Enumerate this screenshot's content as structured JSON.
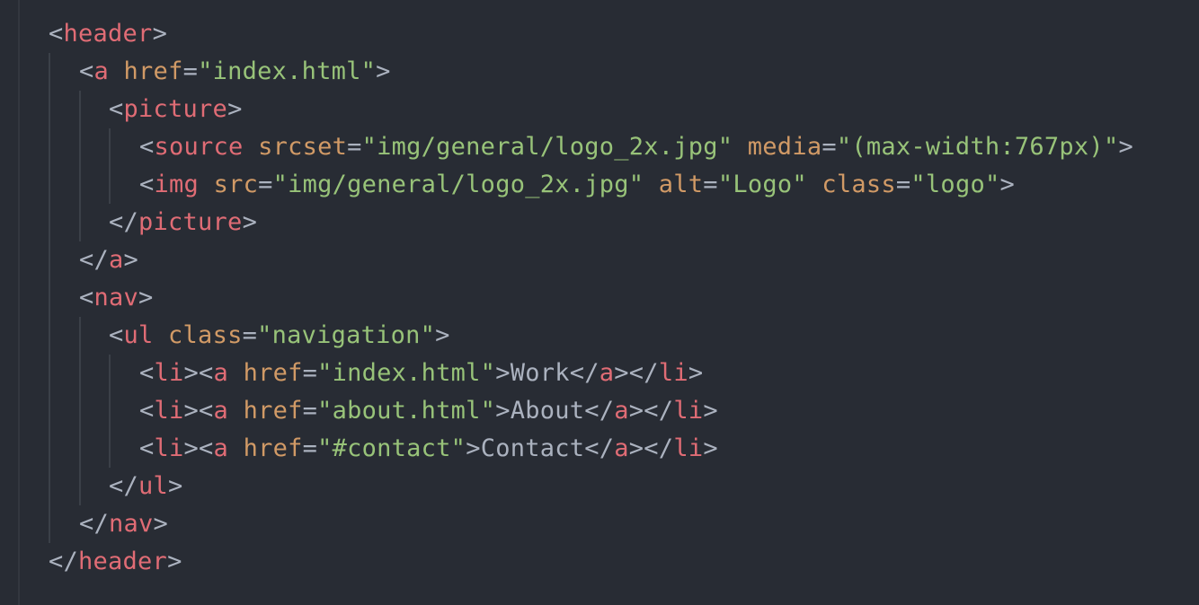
{
  "editor": {
    "colors": {
      "background": "#282c34",
      "punctuation": "#abb2bf",
      "tag": "#e06c75",
      "attribute": "#d19a66",
      "string": "#98c379",
      "text": "#abb2bf"
    },
    "lines": [
      {
        "indent": 0,
        "tokens": [
          {
            "k": "p",
            "v": "<"
          },
          {
            "k": "t",
            "v": "header"
          },
          {
            "k": "p",
            "v": ">"
          }
        ]
      },
      {
        "indent": 1,
        "tokens": [
          {
            "k": "p",
            "v": "<"
          },
          {
            "k": "t",
            "v": "a"
          },
          {
            "k": "p",
            "v": " "
          },
          {
            "k": "a",
            "v": "href"
          },
          {
            "k": "p",
            "v": "="
          },
          {
            "k": "s",
            "v": "\"index.html\""
          },
          {
            "k": "p",
            "v": ">"
          }
        ]
      },
      {
        "indent": 2,
        "tokens": [
          {
            "k": "p",
            "v": "<"
          },
          {
            "k": "t",
            "v": "picture"
          },
          {
            "k": "p",
            "v": ">"
          }
        ]
      },
      {
        "indent": 3,
        "tokens": [
          {
            "k": "p",
            "v": "<"
          },
          {
            "k": "t",
            "v": "source"
          },
          {
            "k": "p",
            "v": " "
          },
          {
            "k": "a",
            "v": "srcset"
          },
          {
            "k": "p",
            "v": "="
          },
          {
            "k": "s",
            "v": "\"img/general/logo_2x.jpg\""
          },
          {
            "k": "p",
            "v": " "
          },
          {
            "k": "a",
            "v": "media"
          },
          {
            "k": "p",
            "v": "="
          },
          {
            "k": "s",
            "v": "\"(max-width:767px)\""
          },
          {
            "k": "p",
            "v": ">"
          }
        ]
      },
      {
        "indent": 3,
        "tokens": [
          {
            "k": "p",
            "v": "<"
          },
          {
            "k": "t",
            "v": "img"
          },
          {
            "k": "p",
            "v": " "
          },
          {
            "k": "a",
            "v": "src"
          },
          {
            "k": "p",
            "v": "="
          },
          {
            "k": "s",
            "v": "\"img/general/logo_2x.jpg\""
          },
          {
            "k": "p",
            "v": " "
          },
          {
            "k": "a",
            "v": "alt"
          },
          {
            "k": "p",
            "v": "="
          },
          {
            "k": "s",
            "v": "\"Logo\""
          },
          {
            "k": "p",
            "v": " "
          },
          {
            "k": "a",
            "v": "class"
          },
          {
            "k": "p",
            "v": "="
          },
          {
            "k": "s",
            "v": "\"logo\""
          },
          {
            "k": "p",
            "v": ">"
          }
        ]
      },
      {
        "indent": 2,
        "tokens": [
          {
            "k": "p",
            "v": "</"
          },
          {
            "k": "t",
            "v": "picture"
          },
          {
            "k": "p",
            "v": ">"
          }
        ]
      },
      {
        "indent": 1,
        "tokens": [
          {
            "k": "p",
            "v": "</"
          },
          {
            "k": "t",
            "v": "a"
          },
          {
            "k": "p",
            "v": ">"
          }
        ]
      },
      {
        "indent": 1,
        "tokens": [
          {
            "k": "p",
            "v": "<"
          },
          {
            "k": "t",
            "v": "nav"
          },
          {
            "k": "p",
            "v": ">"
          }
        ]
      },
      {
        "indent": 2,
        "tokens": [
          {
            "k": "p",
            "v": "<"
          },
          {
            "k": "t",
            "v": "ul"
          },
          {
            "k": "p",
            "v": " "
          },
          {
            "k": "a",
            "v": "class"
          },
          {
            "k": "p",
            "v": "="
          },
          {
            "k": "s",
            "v": "\"navigation\""
          },
          {
            "k": "p",
            "v": ">"
          }
        ]
      },
      {
        "indent": 3,
        "tokens": [
          {
            "k": "p",
            "v": "<"
          },
          {
            "k": "t",
            "v": "li"
          },
          {
            "k": "p",
            "v": "><"
          },
          {
            "k": "t",
            "v": "a"
          },
          {
            "k": "p",
            "v": " "
          },
          {
            "k": "a",
            "v": "href"
          },
          {
            "k": "p",
            "v": "="
          },
          {
            "k": "s",
            "v": "\"index.html\""
          },
          {
            "k": "p",
            "v": ">"
          },
          {
            "k": "x",
            "v": "Work"
          },
          {
            "k": "p",
            "v": "</"
          },
          {
            "k": "t",
            "v": "a"
          },
          {
            "k": "p",
            "v": "></"
          },
          {
            "k": "t",
            "v": "li"
          },
          {
            "k": "p",
            "v": ">"
          }
        ]
      },
      {
        "indent": 3,
        "tokens": [
          {
            "k": "p",
            "v": "<"
          },
          {
            "k": "t",
            "v": "li"
          },
          {
            "k": "p",
            "v": "><"
          },
          {
            "k": "t",
            "v": "a"
          },
          {
            "k": "p",
            "v": " "
          },
          {
            "k": "a",
            "v": "href"
          },
          {
            "k": "p",
            "v": "="
          },
          {
            "k": "s",
            "v": "\"about.html\""
          },
          {
            "k": "p",
            "v": ">"
          },
          {
            "k": "x",
            "v": "About"
          },
          {
            "k": "p",
            "v": "</"
          },
          {
            "k": "t",
            "v": "a"
          },
          {
            "k": "p",
            "v": "></"
          },
          {
            "k": "t",
            "v": "li"
          },
          {
            "k": "p",
            "v": ">"
          }
        ]
      },
      {
        "indent": 3,
        "tokens": [
          {
            "k": "p",
            "v": "<"
          },
          {
            "k": "t",
            "v": "li"
          },
          {
            "k": "p",
            "v": "><"
          },
          {
            "k": "t",
            "v": "a"
          },
          {
            "k": "p",
            "v": " "
          },
          {
            "k": "a",
            "v": "href"
          },
          {
            "k": "p",
            "v": "="
          },
          {
            "k": "s",
            "v": "\"#contact\""
          },
          {
            "k": "p",
            "v": ">"
          },
          {
            "k": "x",
            "v": "Contact"
          },
          {
            "k": "p",
            "v": "</"
          },
          {
            "k": "t",
            "v": "a"
          },
          {
            "k": "p",
            "v": "></"
          },
          {
            "k": "t",
            "v": "li"
          },
          {
            "k": "p",
            "v": ">"
          }
        ]
      },
      {
        "indent": 2,
        "tokens": [
          {
            "k": "p",
            "v": "</"
          },
          {
            "k": "t",
            "v": "ul"
          },
          {
            "k": "p",
            "v": ">"
          }
        ]
      },
      {
        "indent": 1,
        "tokens": [
          {
            "k": "p",
            "v": "</"
          },
          {
            "k": "t",
            "v": "nav"
          },
          {
            "k": "p",
            "v": ">"
          }
        ]
      },
      {
        "indent": 0,
        "tokens": [
          {
            "k": "p",
            "v": "</"
          },
          {
            "k": "t",
            "v": "header"
          },
          {
            "k": "p",
            "v": ">"
          }
        ]
      }
    ]
  }
}
